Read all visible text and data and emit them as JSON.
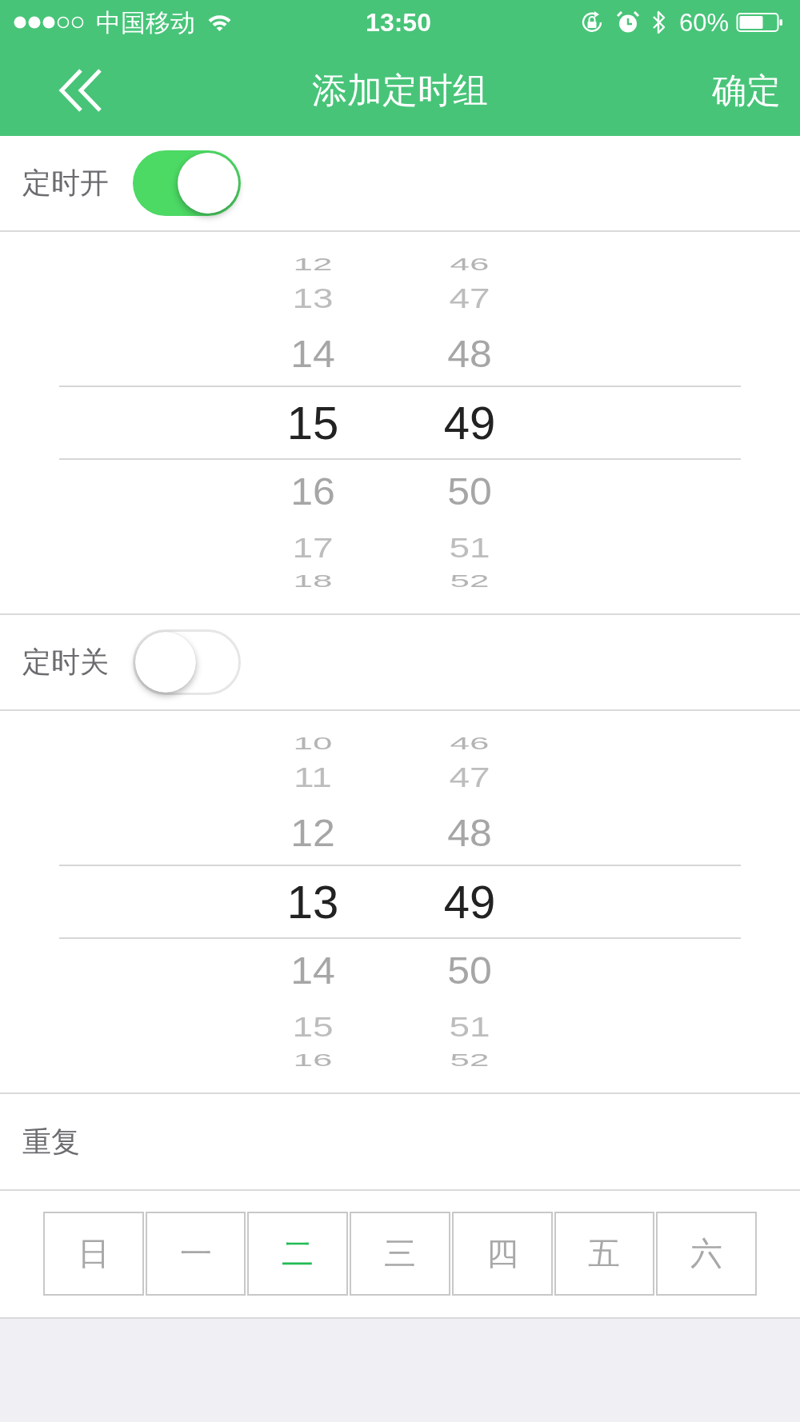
{
  "status_bar": {
    "carrier": "中国移动",
    "time": "13:50",
    "battery": "60%"
  },
  "nav_bar": {
    "title": "添加定时组",
    "confirm_button": "确定"
  },
  "timers": [
    {
      "label": "定时开",
      "on": true,
      "picker": {
        "hours": [
          {
            "text": "12",
            "selected": false
          },
          {
            "text": "13",
            "selected": false
          },
          {
            "text": "14",
            "selected": false
          },
          {
            "text": "15",
            "selected": true
          },
          {
            "text": "16",
            "selected": false
          },
          {
            "text": "17",
            "selected": false
          },
          {
            "text": "18",
            "selected": false
          }
        ],
        "minutes": [
          {
            "text": "46",
            "selected": false
          },
          {
            "text": "47",
            "selected": false
          },
          {
            "text": "48",
            "selected": false
          },
          {
            "text": "49",
            "selected": true
          },
          {
            "text": "50",
            "selected": false
          },
          {
            "text": "51",
            "selected": false
          },
          {
            "text": "52",
            "selected": false
          }
        ]
      }
    },
    {
      "label": "定时关",
      "on": false,
      "picker": {
        "hours": [
          {
            "text": "10",
            "selected": false
          },
          {
            "text": "11",
            "selected": false
          },
          {
            "text": "12",
            "selected": false
          },
          {
            "text": "13",
            "selected": true
          },
          {
            "text": "14",
            "selected": false
          },
          {
            "text": "15",
            "selected": false
          },
          {
            "text": "16",
            "selected": false
          }
        ],
        "minutes": [
          {
            "text": "46",
            "selected": false
          },
          {
            "text": "47",
            "selected": false
          },
          {
            "text": "48",
            "selected": false
          },
          {
            "text": "49",
            "selected": true
          },
          {
            "text": "50",
            "selected": false
          },
          {
            "text": "51",
            "selected": false
          },
          {
            "text": "52",
            "selected": false
          }
        ]
      }
    }
  ],
  "repeat": {
    "label": "重复",
    "days": [
      {
        "label": "日",
        "selected": false
      },
      {
        "label": "一",
        "selected": false
      },
      {
        "label": "二",
        "selected": true
      },
      {
        "label": "三",
        "selected": false
      },
      {
        "label": "四",
        "selected": false
      },
      {
        "label": "五",
        "selected": false
      },
      {
        "label": "六",
        "selected": false
      }
    ]
  }
}
